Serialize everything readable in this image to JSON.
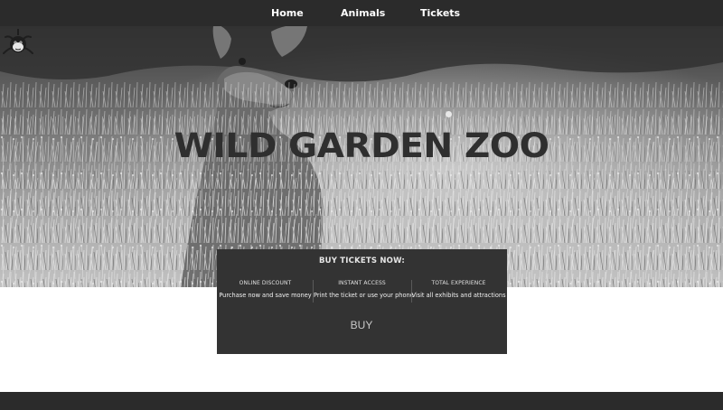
{
  "nav": {
    "items": [
      {
        "label": "Home"
      },
      {
        "label": "Animals"
      },
      {
        "label": "Tickets"
      }
    ]
  },
  "hero": {
    "title": "WILD GARDEN ZOO",
    "logo_icon": "zoo-monkey-logo-icon",
    "background": "deer-in-tall-grass-grayscale-photo"
  },
  "tickets": {
    "heading": "BUY TICKETS NOW:",
    "features": [
      {
        "title": "ONLINE DISCOUNT",
        "description": "Purchase now and save money"
      },
      {
        "title": "INSTANT ACCESS",
        "description": "Print the ticket or use your phone"
      },
      {
        "title": "TOTAL EXPERIENCE",
        "description": "Visit all exhibits and attractions"
      }
    ],
    "buy_label": "BUY"
  },
  "colors": {
    "nav_bg": "#2b2b2b",
    "panel_bg": "#333333",
    "title_text": "#2f2f2f",
    "page_bg": "#ffffff"
  }
}
